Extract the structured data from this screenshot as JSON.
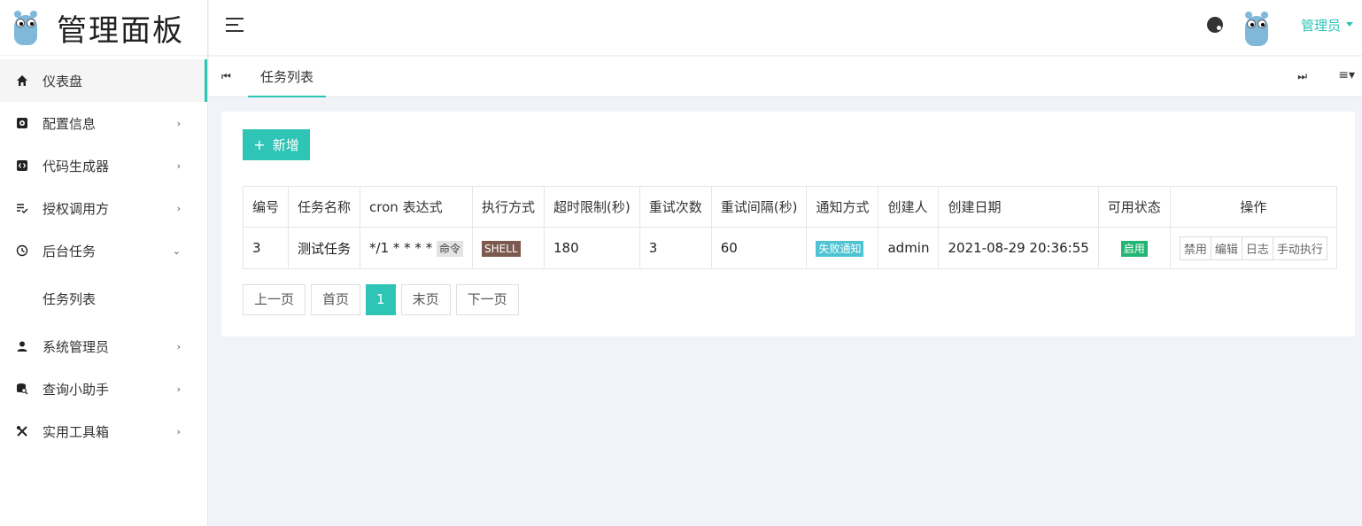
{
  "brand": {
    "title": "管理面板"
  },
  "sidebar": {
    "items": [
      {
        "label": "仪表盘",
        "icon": "home-icon"
      },
      {
        "label": "配置信息",
        "icon": "gear-box-icon"
      },
      {
        "label": "代码生成器",
        "icon": "code-icon"
      },
      {
        "label": "授权调用方",
        "icon": "list-check-icon"
      },
      {
        "label": "后台任务",
        "icon": "clock-icon"
      },
      {
        "label": "系统管理员",
        "icon": "user-icon"
      },
      {
        "label": "查询小助手",
        "icon": "search-db-icon"
      },
      {
        "label": "实用工具箱",
        "icon": "tools-icon"
      }
    ],
    "submenu": {
      "label": "任务列表"
    }
  },
  "header": {
    "user_name": "管理员"
  },
  "tabs": {
    "active_label": "任务列表"
  },
  "toolbar": {
    "add_label": "新增"
  },
  "table": {
    "headers": [
      "编号",
      "任务名称",
      "cron 表达式",
      "执行方式",
      "超时限制(秒)",
      "重试次数",
      "重试间隔(秒)",
      "通知方式",
      "创建人",
      "创建日期",
      "可用状态",
      "操作"
    ],
    "rows": [
      {
        "id": "3",
        "name": "测试任务",
        "cron": "*/1 * * * *",
        "cron_badge": "命令",
        "exec": "SHELL",
        "timeout": "180",
        "retries": "3",
        "retry_interval": "60",
        "notify": "失败通知",
        "creator": "admin",
        "created": "2021-08-29 20:36:55",
        "status": "启用",
        "actions": [
          "禁用",
          "编辑",
          "日志",
          "手动执行"
        ]
      }
    ]
  },
  "pager": {
    "prev": "上一页",
    "first": "首页",
    "current": "1",
    "last": "末页",
    "next": "下一页"
  },
  "colors": {
    "accent": "#2ec4b6",
    "shell": "#7d5a4f",
    "notify": "#4fc3d2",
    "enabled": "#22b573"
  }
}
